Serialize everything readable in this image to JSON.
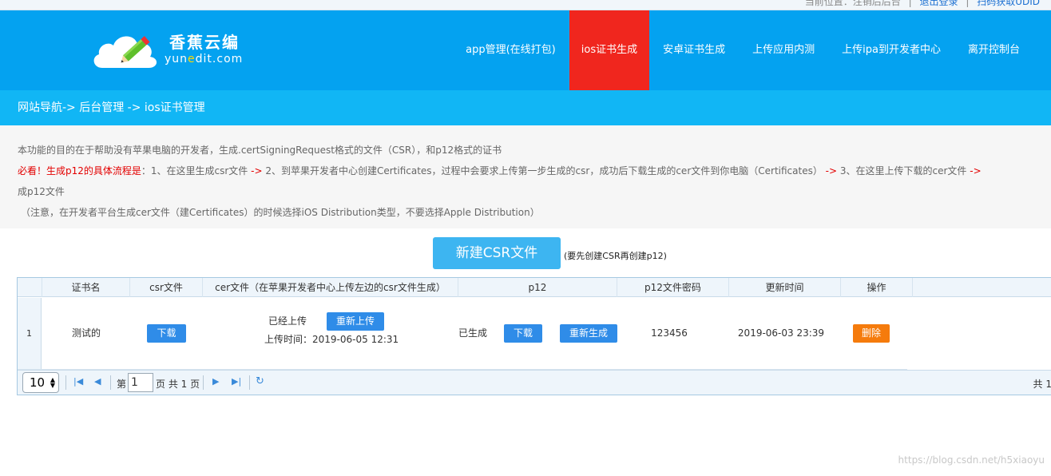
{
  "topbar": {
    "current_location": "当前位置：注销后后台",
    "logout": "退出登录",
    "bind": "扫码获取UDID"
  },
  "logo": {
    "cn": "香蕉云编",
    "en_left": "yun",
    "en_mid": "e",
    "en_right": "dit.com"
  },
  "nav": [
    {
      "label": "app管理(在线打包)"
    },
    {
      "label": "ios证书生成"
    },
    {
      "label": "安卓证书生成"
    },
    {
      "label": "上传应用内测"
    },
    {
      "label": "上传ipa到开发者中心"
    },
    {
      "label": "离开控制台"
    }
  ],
  "breadcrumb": "网站导航-> 后台管理 -> ios证书管理",
  "info": {
    "line1": "本功能的目的在于帮助没有苹果电脑的开发者，生成.certSigningRequest格式的文件（CSR），和p12格式的证书",
    "line2_red": "必看！生成p12的具体流程是",
    "line2_s1": "：1、在这里生成csr文件 ",
    "arrow": "->",
    "line2_s2": " 2、到苹果开发者中心创建Certificates，过程中会要求上传第一步生成的csr，成功后下载生成的cer文件到你电脑（Certificates） ",
    "line2_s3": " 3、在这里上传下载的cer文件 ",
    "line3": "成p12文件",
    "line4": "（注意，在开发者平台生成cer文件（建Certificates）的时候选择iOS Distribution类型，不要选择Apple Distribution）"
  },
  "csr_button": "新建CSR文件",
  "csr_hint": "(要先创建CSR再创建p12)",
  "table": {
    "headers": [
      "证书名",
      "csr文件",
      "cer文件（在苹果开发者中心上传左边的csr文件生成）",
      "p12",
      "p12文件密码",
      "更新时间",
      "操作"
    ],
    "row": {
      "num": "1",
      "name": "测试的",
      "csr_download": "下载",
      "cer_status": "已经上传",
      "cer_reupload": "重新上传",
      "cer_time_label": "上传时间：",
      "cer_time": "2019-06-05 12:31",
      "p12_status": "已生成",
      "p12_download": "下载",
      "p12_regen": "重新生成",
      "password": "123456",
      "updated": "2019-06-03 23:39",
      "delete": "删除"
    }
  },
  "pager": {
    "page_size": "10",
    "page_label": "第",
    "page_value": "1",
    "page_of": "页 共 1 页",
    "total": "共 1"
  },
  "watermark": "https://blog.csdn.net/h5xiaoyu"
}
